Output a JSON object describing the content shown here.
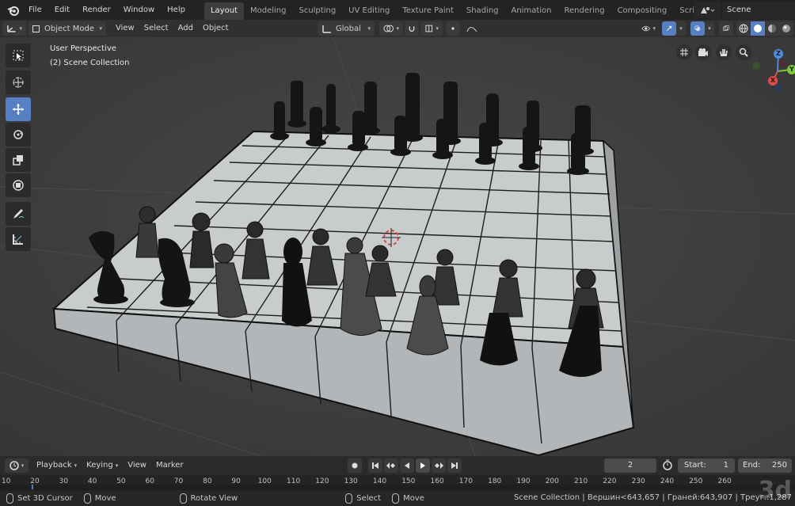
{
  "menu": {
    "items": [
      "File",
      "Edit",
      "Render",
      "Window",
      "Help"
    ]
  },
  "workspaces": [
    {
      "label": "Layout",
      "active": true
    },
    {
      "label": "Modeling",
      "active": false
    },
    {
      "label": "Sculpting",
      "active": false
    },
    {
      "label": "UV Editing",
      "active": false
    },
    {
      "label": "Texture Paint",
      "active": false
    },
    {
      "label": "Shading",
      "active": false
    },
    {
      "label": "Animation",
      "active": false
    },
    {
      "label": "Rendering",
      "active": false
    },
    {
      "label": "Compositing",
      "active": false
    },
    {
      "label": "Scripting",
      "active": false
    }
  ],
  "scene": {
    "name": "Scene"
  },
  "viewport_header": {
    "mode": "Object Mode",
    "menus": [
      "View",
      "Select",
      "Add",
      "Object"
    ],
    "orientation": "Global"
  },
  "viewport": {
    "perspective_label": "User Perspective",
    "collection_label": "(2) Scene Collection",
    "gizmo_axes": {
      "x": "X",
      "y": "Y",
      "z": "Z"
    }
  },
  "toolbar": {
    "tools": [
      "select-box",
      "cursor",
      "move",
      "rotate",
      "scale",
      "transform",
      "annotate",
      "measure"
    ],
    "active_tool": "move"
  },
  "timeline": {
    "menus": [
      "Playback",
      "Keying",
      "View",
      "Marker"
    ],
    "current_frame": "2",
    "start_label": "Start:",
    "start": "1",
    "end_label": "End:",
    "end": "250",
    "ruler_ticks": [
      "10",
      "20",
      "30",
      "40",
      "50",
      "60",
      "70",
      "80",
      "90",
      "100",
      "110",
      "120",
      "130",
      "140",
      "150",
      "160",
      "170",
      "180",
      "190",
      "200",
      "210",
      "220",
      "230",
      "240",
      "250",
      "260"
    ]
  },
  "statusbar": {
    "left_action": "Set 3D Cursor",
    "middle_left": "Move",
    "middle_action": "Rotate View",
    "select_action": "Select",
    "move_action": "Move",
    "stats": "Scene Collection | Вершин<643,657 | Граней:643,907 | Треуг.:1,287"
  },
  "watermark": "3d",
  "colors": {
    "accent": "#5680c2",
    "viewport_bg": "#3d3d3d",
    "board": "#c9cccd",
    "pieces": "#151515"
  }
}
